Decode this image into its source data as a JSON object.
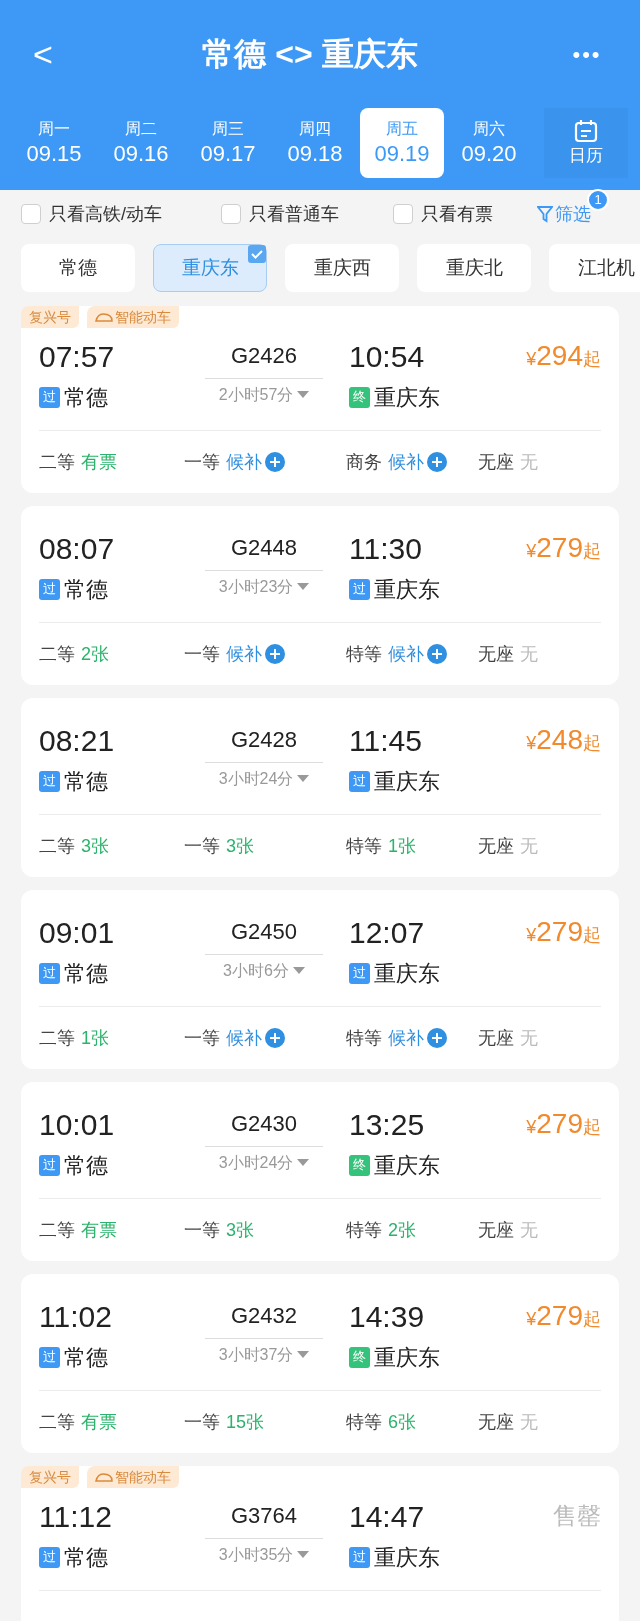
{
  "header": {
    "back": "<",
    "title": "常德 <> 重庆东",
    "more": "•••"
  },
  "dates": [
    {
      "weekday": "周一",
      "date": "09.15",
      "selected": false
    },
    {
      "weekday": "周二",
      "date": "09.16",
      "selected": false
    },
    {
      "weekday": "周三",
      "date": "09.17",
      "selected": false
    },
    {
      "weekday": "周四",
      "date": "09.18",
      "selected": false
    },
    {
      "weekday": "周五",
      "date": "09.19",
      "selected": true
    },
    {
      "weekday": "周六",
      "date": "09.20",
      "selected": false
    }
  ],
  "calendar": {
    "label": "日历"
  },
  "filters": [
    {
      "label": "只看高铁/动车",
      "checked": false
    },
    {
      "label": "只看普通车",
      "checked": false
    },
    {
      "label": "只看有票",
      "checked": false
    }
  ],
  "filter_button": {
    "label": "筛选",
    "badge": "1"
  },
  "stations": [
    {
      "label": "常德",
      "selected": false
    },
    {
      "label": "重庆东",
      "selected": true
    },
    {
      "label": "重庆西",
      "selected": false
    },
    {
      "label": "重庆北",
      "selected": false
    },
    {
      "label": "江北机",
      "selected": false
    }
  ],
  "trains": [
    {
      "tags": [
        "复兴号",
        "智能动车"
      ],
      "depart": "07:57",
      "number": "G2426",
      "duration": "2小时57分",
      "arrive": "10:54",
      "from": {
        "badge": "过",
        "kind": "pass",
        "name": "常德"
      },
      "to": {
        "badge": "终",
        "kind": "terminal",
        "name": "重庆东"
      },
      "price": {
        "currency": "¥",
        "amount": "294",
        "suffix": "起"
      },
      "seats": [
        {
          "class": "二等",
          "status": "有票",
          "kind": "available"
        },
        {
          "class": "一等",
          "status": "候补",
          "kind": "waitlist"
        },
        {
          "class": "商务",
          "status": "候补",
          "kind": "waitlist"
        },
        {
          "class": "无座",
          "status": "无",
          "kind": "none"
        }
      ]
    },
    {
      "depart": "08:07",
      "number": "G2448",
      "duration": "3小时23分",
      "arrive": "11:30",
      "from": {
        "badge": "过",
        "kind": "pass",
        "name": "常德"
      },
      "to": {
        "badge": "过",
        "kind": "pass",
        "name": "重庆东"
      },
      "price": {
        "currency": "¥",
        "amount": "279",
        "suffix": "起"
      },
      "seats": [
        {
          "class": "二等",
          "status": "2张",
          "kind": "available"
        },
        {
          "class": "一等",
          "status": "候补",
          "kind": "waitlist"
        },
        {
          "class": "特等",
          "status": "候补",
          "kind": "waitlist"
        },
        {
          "class": "无座",
          "status": "无",
          "kind": "none"
        }
      ]
    },
    {
      "depart": "08:21",
      "number": "G2428",
      "duration": "3小时24分",
      "arrive": "11:45",
      "from": {
        "badge": "过",
        "kind": "pass",
        "name": "常德"
      },
      "to": {
        "badge": "过",
        "kind": "pass",
        "name": "重庆东"
      },
      "price": {
        "currency": "¥",
        "amount": "248",
        "suffix": "起"
      },
      "seats": [
        {
          "class": "二等",
          "status": "3张",
          "kind": "available"
        },
        {
          "class": "一等",
          "status": "3张",
          "kind": "available"
        },
        {
          "class": "特等",
          "status": "1张",
          "kind": "available"
        },
        {
          "class": "无座",
          "status": "无",
          "kind": "none"
        }
      ]
    },
    {
      "depart": "09:01",
      "number": "G2450",
      "duration": "3小时6分",
      "arrive": "12:07",
      "from": {
        "badge": "过",
        "kind": "pass",
        "name": "常德"
      },
      "to": {
        "badge": "过",
        "kind": "pass",
        "name": "重庆东"
      },
      "price": {
        "currency": "¥",
        "amount": "279",
        "suffix": "起"
      },
      "seats": [
        {
          "class": "二等",
          "status": "1张",
          "kind": "available"
        },
        {
          "class": "一等",
          "status": "候补",
          "kind": "waitlist"
        },
        {
          "class": "特等",
          "status": "候补",
          "kind": "waitlist"
        },
        {
          "class": "无座",
          "status": "无",
          "kind": "none"
        }
      ]
    },
    {
      "depart": "10:01",
      "number": "G2430",
      "duration": "3小时24分",
      "arrive": "13:25",
      "from": {
        "badge": "过",
        "kind": "pass",
        "name": "常德"
      },
      "to": {
        "badge": "终",
        "kind": "terminal",
        "name": "重庆东"
      },
      "price": {
        "currency": "¥",
        "amount": "279",
        "suffix": "起"
      },
      "seats": [
        {
          "class": "二等",
          "status": "有票",
          "kind": "available"
        },
        {
          "class": "一等",
          "status": "3张",
          "kind": "available"
        },
        {
          "class": "特等",
          "status": "2张",
          "kind": "available"
        },
        {
          "class": "无座",
          "status": "无",
          "kind": "none"
        }
      ]
    },
    {
      "depart": "11:02",
      "number": "G2432",
      "duration": "3小时37分",
      "arrive": "14:39",
      "from": {
        "badge": "过",
        "kind": "pass",
        "name": "常德"
      },
      "to": {
        "badge": "终",
        "kind": "terminal",
        "name": "重庆东"
      },
      "price": {
        "currency": "¥",
        "amount": "279",
        "suffix": "起"
      },
      "seats": [
        {
          "class": "二等",
          "status": "有票",
          "kind": "available"
        },
        {
          "class": "一等",
          "status": "15张",
          "kind": "available"
        },
        {
          "class": "特等",
          "status": "6张",
          "kind": "available"
        },
        {
          "class": "无座",
          "status": "无",
          "kind": "none"
        }
      ]
    },
    {
      "tags": [
        "复兴号",
        "智能动车"
      ],
      "depart": "11:12",
      "number": "G3764",
      "duration": "3小时35分",
      "arrive": "14:47",
      "from": {
        "badge": "过",
        "kind": "pass",
        "name": "常德"
      },
      "to": {
        "badge": "过",
        "kind": "pass",
        "name": "重庆东"
      },
      "sold_out": "售罄"
    }
  ]
}
